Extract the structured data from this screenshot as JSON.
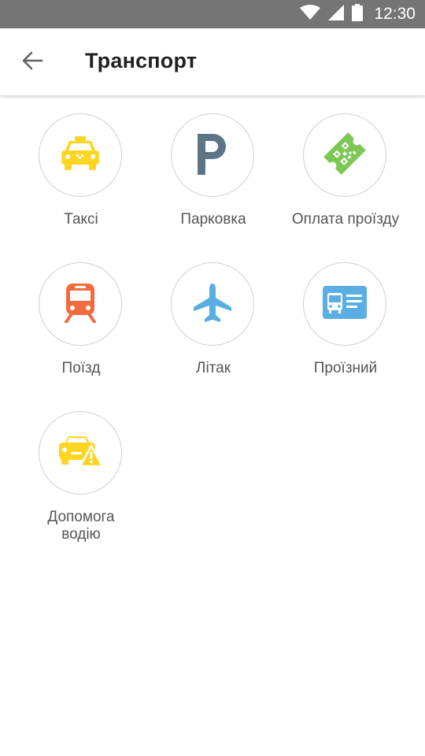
{
  "status_bar": {
    "time": "12:30",
    "icons": [
      "wifi-icon",
      "cell-signal-icon",
      "battery-icon"
    ]
  },
  "header": {
    "title": "Транспорт",
    "back_icon": "back-arrow-icon"
  },
  "tiles": [
    {
      "label": "Таксі",
      "icon": "taxi-icon",
      "color": "#FFD524"
    },
    {
      "label": "Парковка",
      "icon": "parking-icon",
      "color": "#5B7585"
    },
    {
      "label": "Оплата проїзду",
      "icon": "ticket-qr-icon",
      "color": "#7DC855"
    },
    {
      "label": "Поїзд",
      "icon": "train-icon",
      "color": "#F26B40"
    },
    {
      "label": "Літак",
      "icon": "airplane-icon",
      "color": "#5AAEE4"
    },
    {
      "label": "Проїзний",
      "icon": "travel-card-icon",
      "color": "#5AAEE4"
    },
    {
      "label": "Допомога\nводію",
      "icon": "car-warning-icon",
      "color": "#FFD524"
    }
  ],
  "colors": {
    "status_bar": "#757575",
    "title_text": "#212121",
    "label_text": "#555555",
    "circle_border": "#cfcfcf"
  }
}
